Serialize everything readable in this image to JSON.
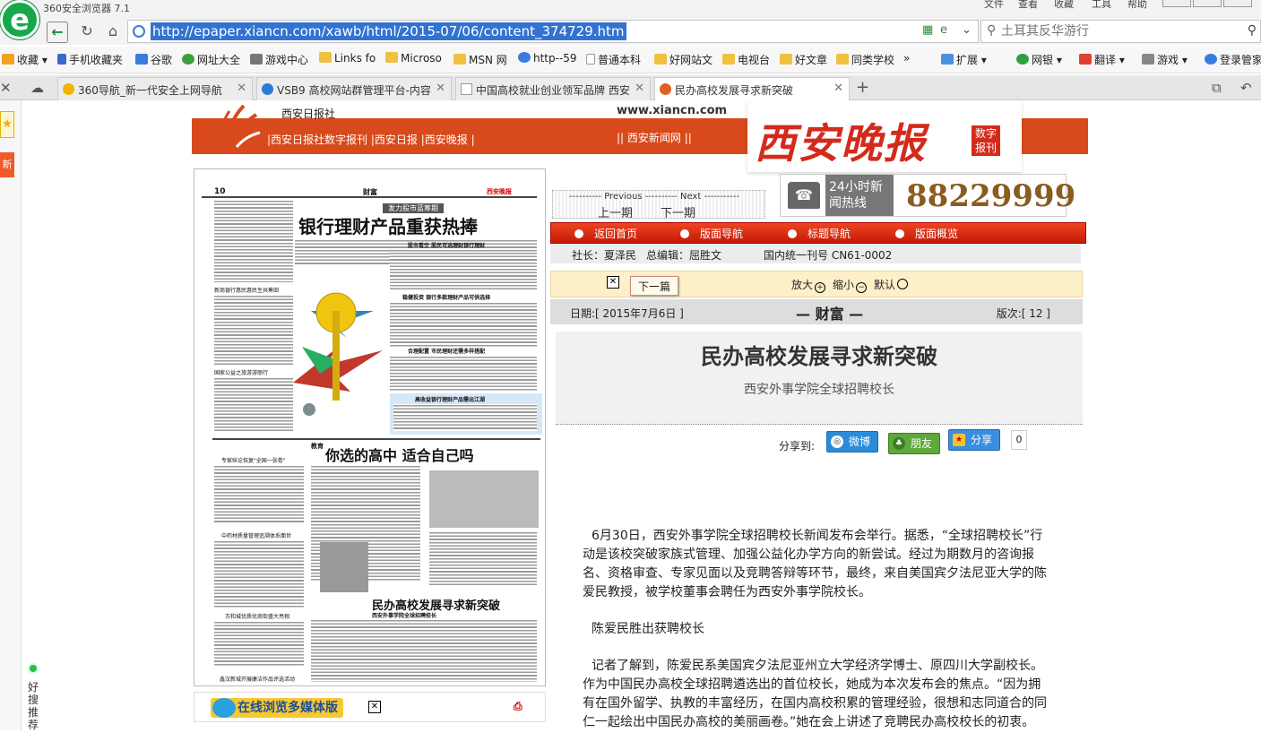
{
  "browser": {
    "title": "360安全浏览器 7.1",
    "menu": [
      "文件",
      "查看",
      "收藏",
      "工具",
      "帮助"
    ],
    "url": "http://epaper.xiancn.com/xawb/html/2015-07/06/content_374729.htm",
    "search_placeholder": "土耳其反华游行",
    "bookmarks": [
      "收藏",
      "手机收藏夹",
      "谷歌",
      "网址大全",
      "游戏中心",
      "Links fo",
      "Microso",
      "MSN 网",
      "http--59",
      "普通本科",
      "好网站文",
      "电视台",
      "好文章",
      "同类学校"
    ],
    "right_tools": [
      "扩展",
      "网银",
      "翻译",
      "游戏",
      "登录管家"
    ],
    "tabs": [
      {
        "label": "360导航_新一代安全上网导航",
        "color": "#f2b400"
      },
      {
        "label": "VSB9 高校网站群管理平台-内容",
        "color": "#2a7bd6"
      },
      {
        "label": "中国高校就业创业领军品牌 西安",
        "color": "#cccccc"
      },
      {
        "label": "民办高校发展寻求新突破",
        "color": "#e06020"
      }
    ],
    "sidebar": {
      "fav": "新",
      "haosou": "好搜推荐"
    }
  },
  "page": {
    "xa_daily": "西安日报社",
    "site_url": "www.xiancn.com",
    "top_links": "|西安日报社数字报刊 |西安日报 |西安晚报 |",
    "news_net": "|| 西安新闻网 ||",
    "masthead": "西安晚报",
    "masthead_badge": "数字报刊",
    "hotline_label": "24小时新闻热线",
    "hotline_number": "88229999",
    "pn_labels": "---------- Previous ---------- Next -----------",
    "prev": "上一期",
    "next": "下一期",
    "nav": [
      "返回首页",
      "版面导航",
      "标题导航",
      "版面概览"
    ],
    "meta": {
      "publisher": "社长：夏泽民",
      "editor": "总编辑：屈胜文",
      "issn": "国内统一刊号  CN61-0002"
    },
    "next_article": "下一篇",
    "zoom": {
      "in": "放大",
      "out": "缩小",
      "default": "默认"
    },
    "date": "日期:[ 2015年7月6日 ]",
    "section": "— 财富 —",
    "page_no": "版次:[ 12 ]",
    "newspaper": {
      "page_no": "10",
      "section": "财富",
      "brand": "西安晚报",
      "kicker": "发力股市蓝筹期",
      "headline1": "银行理财产品重获热捧",
      "sub1": "股市看空  股民可选理财银行理财",
      "sub2": "稳健投资  银行多款理财产品可供选择",
      "sub3": "合理配置  市民理财还需多样搭配",
      "sub4": "高收益银行理财产品需出江湖",
      "side1": "新商银行惠民惠民生共筹田",
      "side2": "国家公益之旅游游丽行",
      "side3": "专家纵论恢复\"全国一张卷\"",
      "side4": "中药材质量管理追溯体系面世",
      "side5": "万和城优质优商街盛大亮相",
      "side6": "鑫汉新城开展廉洁作品评选活动",
      "edu": "教育",
      "headline2": "你选的高中  适合自己吗",
      "headline3": "民办高校发展寻求新突破",
      "sub5": "西安外事学院全球招聘校长"
    },
    "media_label": "在线浏览多媒体版",
    "article": {
      "title": "民办高校发展寻求新突破",
      "subtitle": "西安外事学院全球招聘校长",
      "share_label": "分享到:",
      "share": [
        "微博",
        "朋友",
        "分享"
      ],
      "share_count": "0",
      "paragraphs": [
        "6月30日，西安外事学院全球招聘校长新闻发布会举行。据悉，“全球招聘校长”行动是该校突破家族式管理、加强公益化办学方向的新尝试。经过为期数月的咨询报名、资格审查、专家见面以及竞聘答辩等环节，最终，来自美国宾夕法尼亚大学的陈爱民教授，被学校董事会聘任为西安外事学院校长。",
        "陈爱民胜出获聘校长",
        "记者了解到，陈爱民系美国宾夕法尼亚州立大学经济学博士、原四川大学副校长。作为中国民办高校全球招聘遴选出的首位校长，她成为本次发布会的焦点。“因为拥有在国外留学、执教的丰富经历，在国内高校积累的管理经验，很想和志同道合的同仁一起绘出中国民办高校的美丽画卷。”她在会上讲述了竞聘民办高校校长的初衷。"
      ]
    }
  }
}
